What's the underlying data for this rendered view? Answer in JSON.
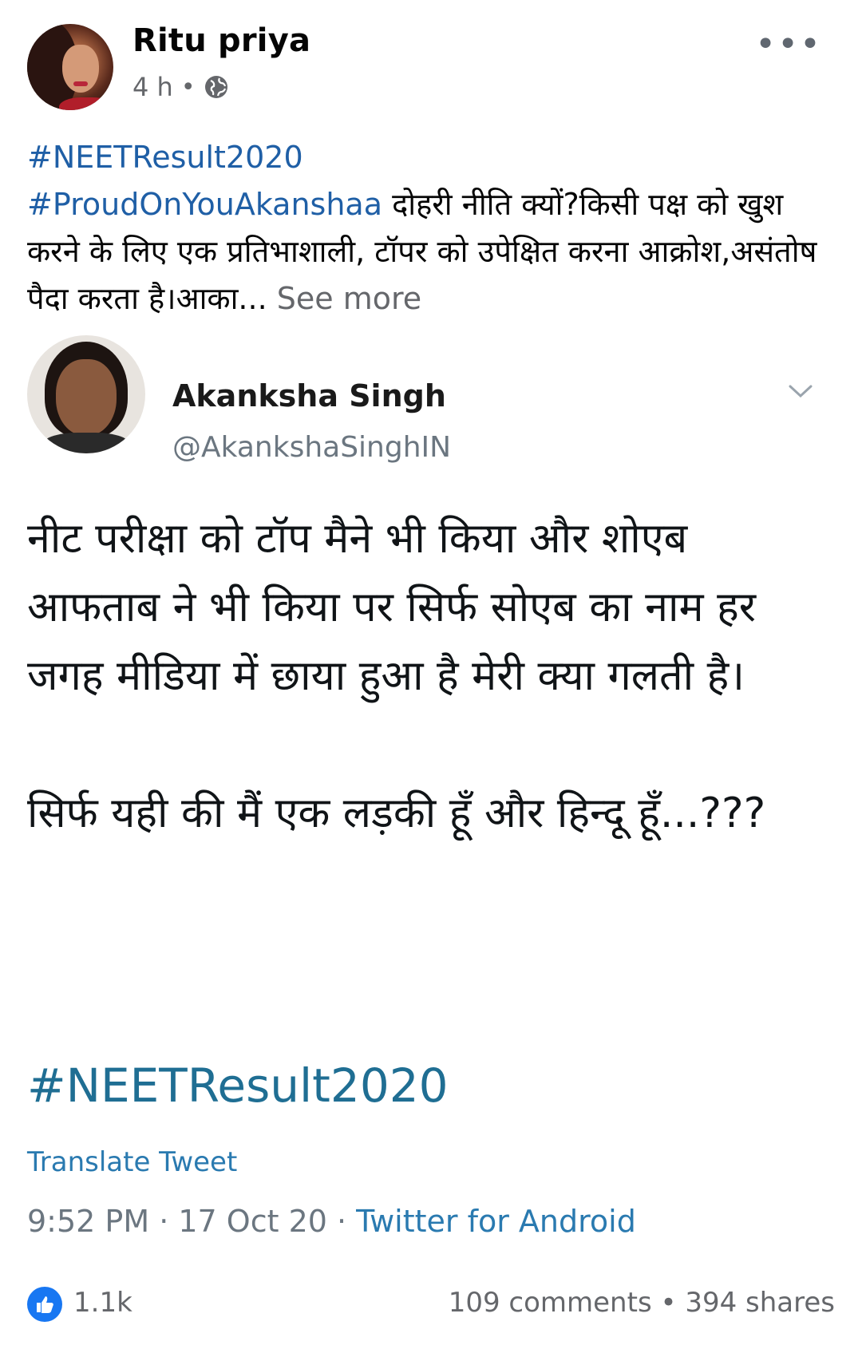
{
  "post": {
    "author": "Ritu priya",
    "time": "4 h",
    "separator": "•",
    "more_icon": "more-horizontal-icon",
    "privacy_icon": "globe-icon",
    "hashtag1": "#NEETResult2020",
    "hashtag2": "#ProudOnYouAkanshaa",
    "text": " दोहरी नीति क्यों?किसी पक्ष को खुश करने के लिए एक प्रतिभाशाली, टॉपर को उपेक्षित करना आक्रोश,असंतोष पैदा करता है।आका...",
    "see_more": " See more"
  },
  "tweet": {
    "name": "Akanksha Singh",
    "handle": "@AkankshaSinghIN",
    "body_p1": "नीट परीक्षा को टॉप मैने भी किया और शोएब आफताब ने भी किया पर सिर्फ सोएब का नाम हर जगह मीडिया में छाया हुआ है मेरी क्या गलती है।",
    "body_p2": "सिर्फ यही की मैं एक लड़की हूँ और हिन्दू हूँ...???",
    "hashtag": "#NEETResult2020",
    "translate": "Translate Tweet",
    "time": "9:52 PM · 17 Oct 20 · ",
    "source": "Twitter for Android"
  },
  "footer": {
    "likes": "1.1k",
    "comments": "109 comments",
    "dot": " • ",
    "shares": "394 shares"
  },
  "colors": {
    "link": "#1f5fa6",
    "tweet_link": "#2a7ab0",
    "like_blue": "#1877f2",
    "muted": "#65676b"
  }
}
